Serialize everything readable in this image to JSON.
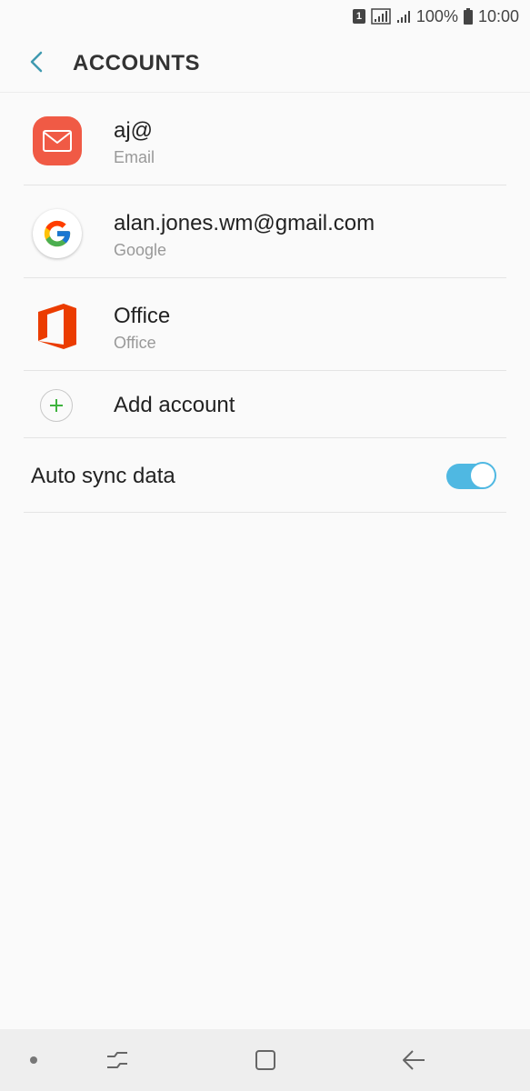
{
  "status_bar": {
    "sim": "1",
    "battery_percent": "100%",
    "time": "10:00"
  },
  "header": {
    "title": "ACCOUNTS",
    "back_icon": "chevron-left-icon",
    "accent_color": "#3f9ab0"
  },
  "accounts": [
    {
      "name": "aj@",
      "type": "Email",
      "icon": "email-icon",
      "icon_color": "#f05a45"
    },
    {
      "name": "alan.jones.wm@gmail.com",
      "type": "Google",
      "icon": "google-icon"
    },
    {
      "name": "Office",
      "type": "Office",
      "icon": "office-icon",
      "icon_color": "#eb3c00"
    }
  ],
  "add_account": {
    "label": "Add account",
    "icon": "plus-icon",
    "icon_color": "#3db33d"
  },
  "auto_sync": {
    "label": "Auto sync data",
    "enabled": true,
    "toggle_color": "#4fb8e2"
  },
  "nav_bar": {
    "buttons": [
      "recents-icon",
      "home-icon",
      "back-icon"
    ]
  }
}
